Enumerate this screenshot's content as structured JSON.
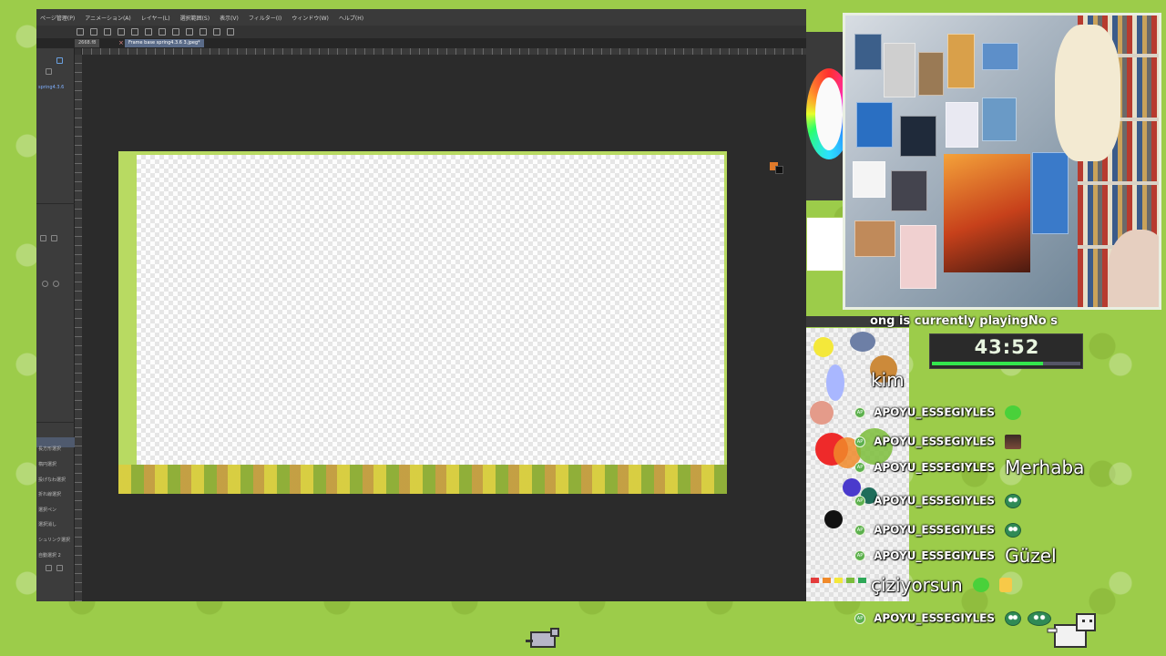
{
  "editor": {
    "menu": [
      "ページ管理(P)",
      "アニメーション(A)",
      "レイヤー(L)",
      "選択範囲(S)",
      "表示(V)",
      "フィルター(I)",
      "ウィンドウ(W)",
      "ヘルプ(H)"
    ],
    "tabs": [
      {
        "label": "2668.f8"
      },
      {
        "label": "Frame base spring4.3.6 3.jpeg*"
      }
    ],
    "layer_name": "spring4.3.6",
    "left_panel_items": [
      "長方形選択",
      "楕円選択",
      "投げなわ選択",
      "折れ線選択",
      "選択ペン",
      "選択消し",
      "シュリンク選択",
      "自動選択 2"
    ]
  },
  "overlay": {
    "now_playing": "ong is currently playingNo s",
    "timer": {
      "text": "43:52",
      "progress_fraction": 0.75
    },
    "chat": [
      {
        "kind": "message-only",
        "message": "kim"
      },
      {
        "user": "APOYU_ESSEGIYLES",
        "badge": "AP",
        "emotes": [
          "green-smile-emote"
        ]
      },
      {
        "user": "APOYU_ESSEGIYLES",
        "badge": "AP",
        "emotes": [
          "face-emote"
        ]
      },
      {
        "user": "APOYU_ESSEGIYLES",
        "badge": "AP",
        "message": "Merhaba"
      },
      {
        "user": "APOYU_ESSEGIYLES",
        "badge": "AP",
        "emotes": [
          "frog-emote"
        ]
      },
      {
        "user": "APOYU_ESSEGIYLES",
        "badge": "AP",
        "emotes": [
          "frog-emote"
        ]
      },
      {
        "user": "APOYU_ESSEGIYLES",
        "badge": "AP",
        "message": "Güzel"
      },
      {
        "kind": "continuation",
        "message": "çiziyorsun",
        "emotes": [
          "green-smile-emote",
          "thumbs-up-emote"
        ]
      },
      {
        "user": "APOYU_ESSEGIYLES",
        "badge": "AP",
        "emotes": [
          "frog-emote",
          "frog-hug-emote"
        ]
      }
    ]
  },
  "colors": {
    "background_green": "#9ccc4a",
    "timer_green": "#33e64d",
    "badge_green": "#5cb04d",
    "editor_dark": "#2b2b2b"
  }
}
